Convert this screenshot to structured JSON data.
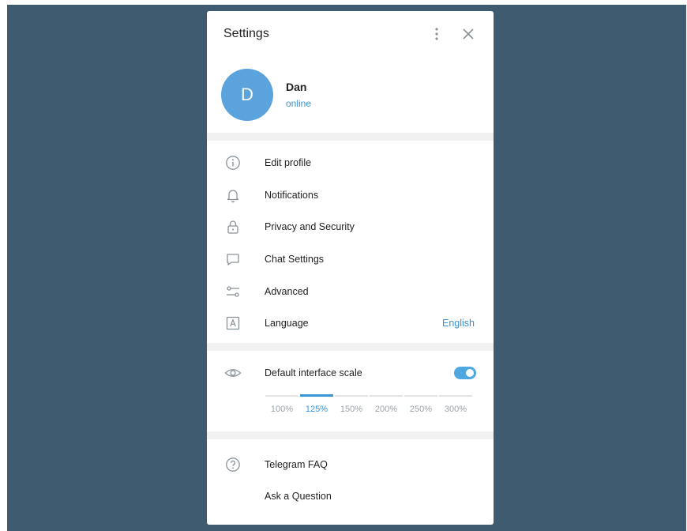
{
  "window": {
    "title": "Settings"
  },
  "header": {
    "more_icon": "vertical-dots-icon",
    "close_icon": "close-icon"
  },
  "profile": {
    "avatar_letter": "D",
    "name": "Dan",
    "status": "online",
    "avatar_color": "#5ba3dd"
  },
  "menu": [
    {
      "label": "Edit profile",
      "icon": "info-icon"
    },
    {
      "label": "Notifications",
      "icon": "bell-icon"
    },
    {
      "label": "Privacy and Security",
      "icon": "lock-icon"
    },
    {
      "label": "Chat Settings",
      "icon": "chat-icon"
    },
    {
      "label": "Advanced",
      "icon": "sliders-icon"
    },
    {
      "label": "Language",
      "icon": "language-icon",
      "value": "English"
    }
  ],
  "scale": {
    "label": "Default interface scale",
    "icon": "eye-icon",
    "enabled": true,
    "options": [
      "100%",
      "125%",
      "150%",
      "200%",
      "250%",
      "300%"
    ],
    "selected": "125%"
  },
  "help": [
    {
      "label": "Telegram FAQ",
      "icon": "question-icon"
    },
    {
      "label": "Ask a Question",
      "icon": ""
    }
  ],
  "colors": {
    "accent": "#3a93d4",
    "background": "#3e5b6f"
  }
}
